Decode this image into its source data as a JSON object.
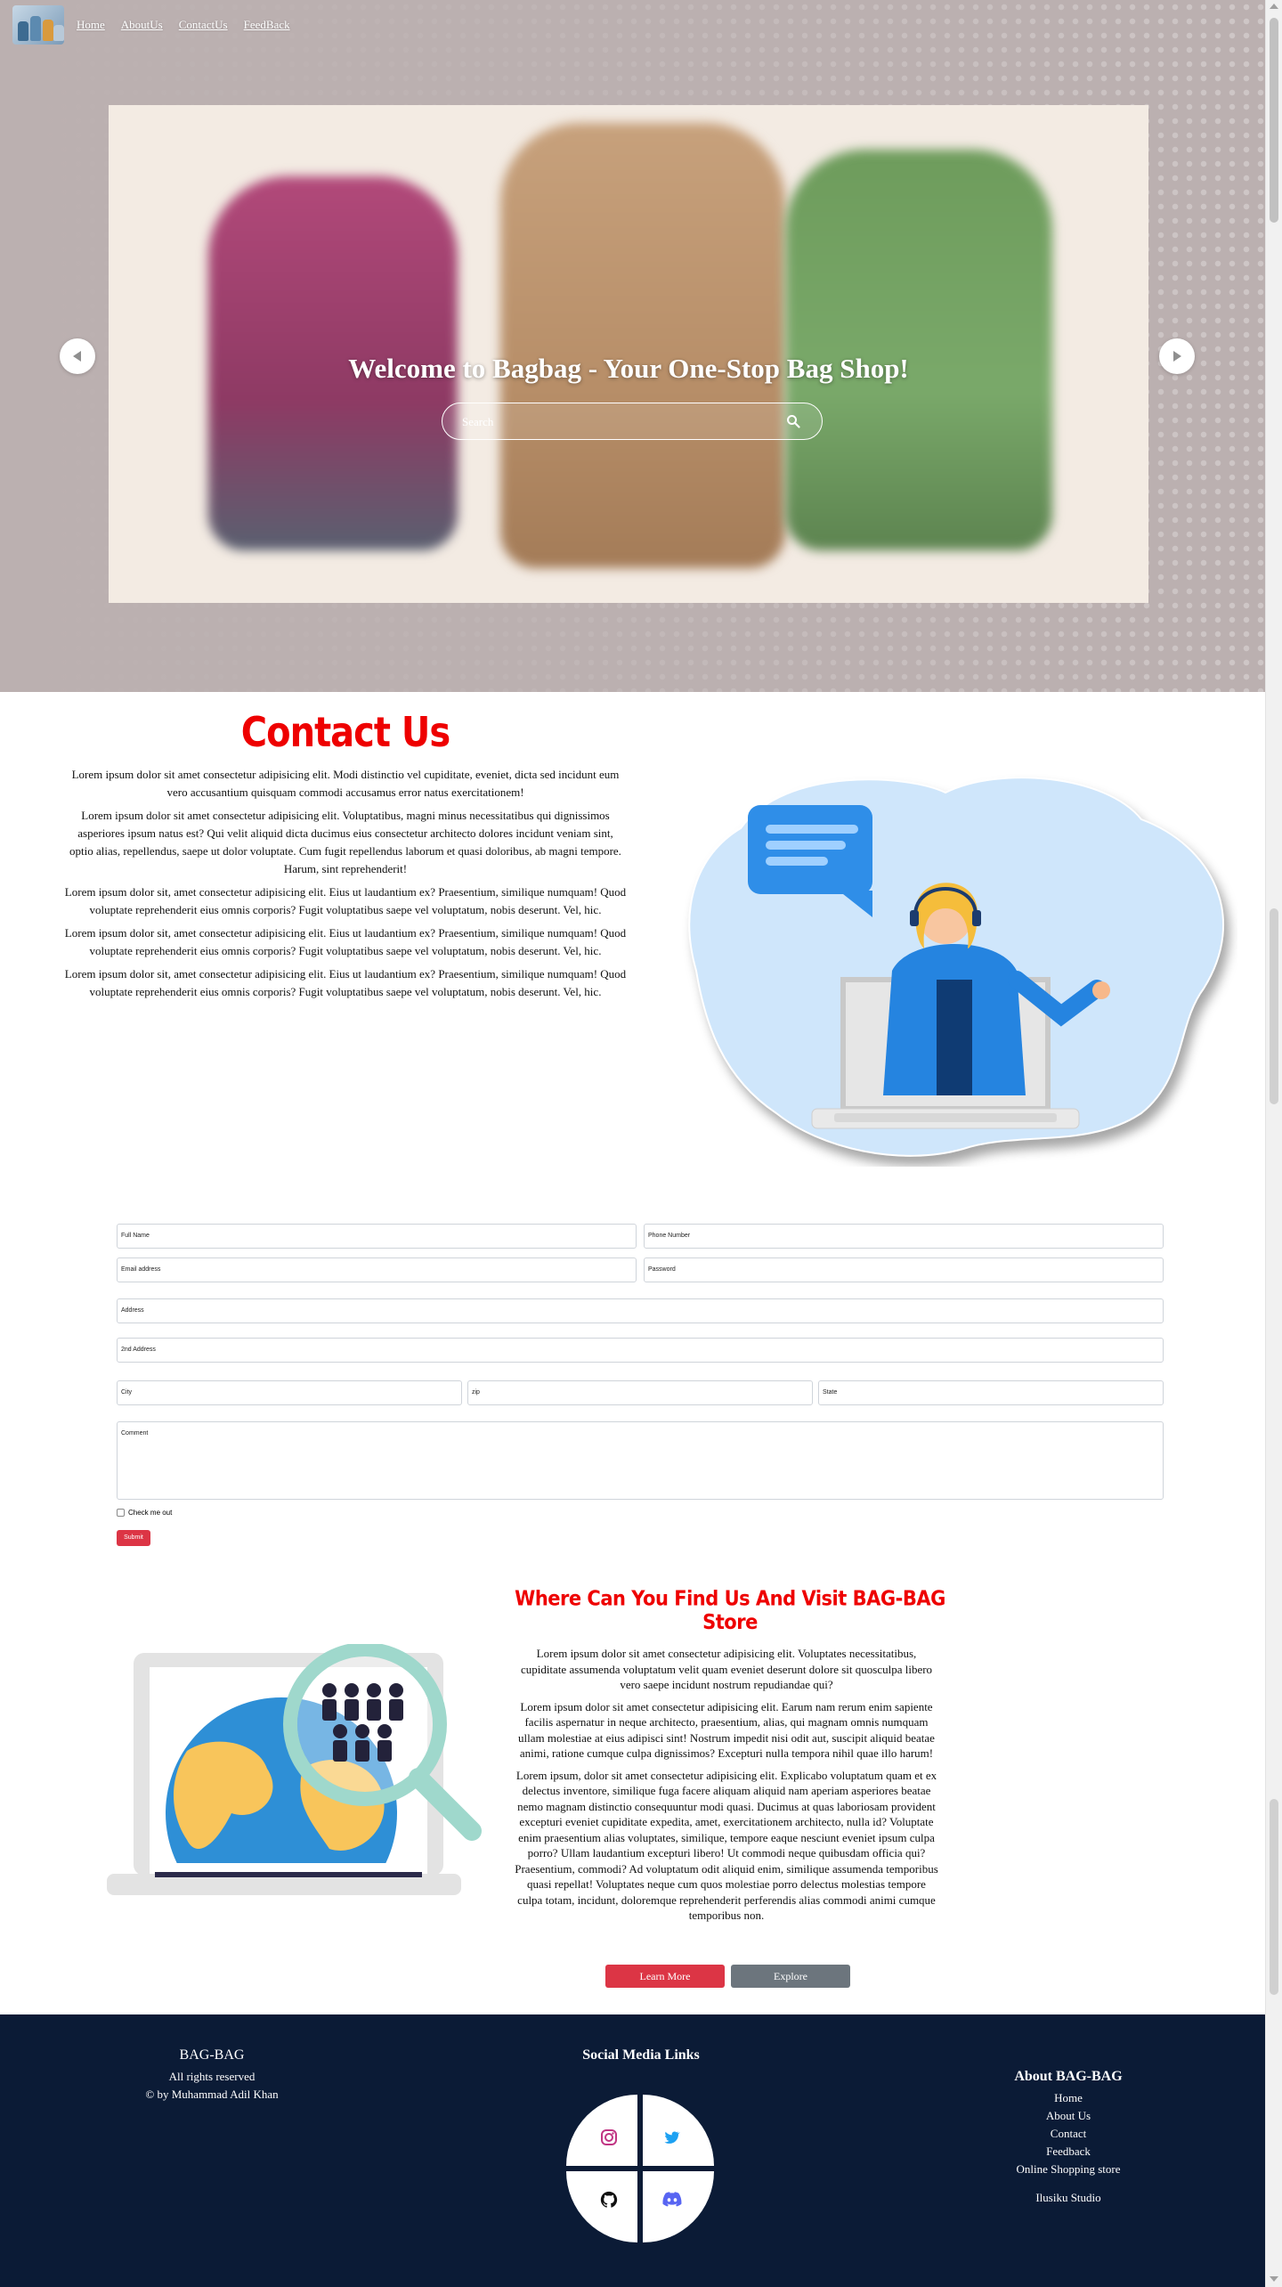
{
  "nav": {
    "logo_alt": "bag-logo",
    "links": [
      "Home",
      "AboutUs",
      "ContactUs",
      "FeedBack"
    ]
  },
  "hero": {
    "title": "Welcome to Bagbag - Your One-Stop Bag Shop!",
    "search_placeholder": "Search"
  },
  "contact": {
    "title": "Contact Us",
    "paragraphs": [
      "Lorem ipsum dolor sit amet consectetur adipisicing elit. Modi distinctio vel cupiditate, eveniet, dicta sed incidunt eum vero accusantium quisquam commodi accusamus error natus exercitationem!",
      "Lorem ipsum dolor sit amet consectetur adipisicing elit. Voluptatibus, magni minus necessitatibus qui dignissimos asperiores ipsum natus est? Qui velit aliquid dicta ducimus eius consectetur architecto dolores incidunt veniam sint,",
      "optio alias, repellendus, saepe ut dolor voluptate. Cum fugit repellendus laborum et quasi doloribus, ab magni tempore. Harum, sint reprehenderit!",
      "Lorem ipsum dolor sit, amet consectetur adipisicing elit. Eius ut laudantium ex? Praesentium, similique numquam! Quod voluptate reprehenderit eius omnis corporis? Fugit voluptatibus saepe vel voluptatum, nobis deserunt. Vel, hic.",
      "Lorem ipsum dolor sit, amet consectetur adipisicing elit. Eius ut laudantium ex? Praesentium, similique numquam! Quod voluptate reprehenderit eius omnis corporis? Fugit voluptatibus saepe vel voluptatum, nobis deserunt. Vel, hic.",
      "Lorem ipsum dolor sit, amet consectetur adipisicing elit. Eius ut laudantium ex? Praesentium, similique numquam! Quod voluptate reprehenderit eius omnis corporis? Fugit voluptatibus saepe vel voluptatum, nobis deserunt. Vel, hic."
    ]
  },
  "form": {
    "full_name": "Full Name",
    "phone": "Phone Number",
    "email": "Email address",
    "password": "Password",
    "address": "Address",
    "address2": "2nd Address",
    "city": "City",
    "zip": "zip",
    "state": "State",
    "comment": "Comment",
    "check_label": "Check me out",
    "submit": "Submit"
  },
  "find": {
    "title": "Where Can You Find Us And Visit BAG-BAG Store",
    "paragraphs": [
      "Lorem ipsum dolor sit amet consectetur adipisicing elit. Voluptates necessitatibus, cupiditate assumenda voluptatum velit quam eveniet deserunt dolore sit quosculpa libero vero saepe incidunt nostrum repudiandae qui?",
      "Lorem ipsum dolor sit amet consectetur adipisicing elit. Earum nam rerum enim sapiente facilis aspernatur in neque architecto, praesentium, alias, qui magnam omnis numquam ullam molestiae at eius adipisci sint! Nostrum impedit nisi odit aut, suscipit aliquid beatae animi, ratione cumque culpa dignissimos? Excepturi nulla tempora nihil quae illo harum!",
      "Lorem ipsum, dolor sit amet consectetur adipisicing elit. Explicabo voluptatum quam et ex delectus inventore, similique fuga facere aliquam aliquid nam aperiam asperiores beatae nemo magnam distinctio consequuntur modi quasi. Ducimus at quas laboriosam provident excepturi eveniet cupiditate expedita, amet, exercitationem architecto, nulla id? Voluptate enim praesentium alias voluptates, similique, tempore eaque nesciunt eveniet ipsum culpa porro? Ullam laudantium excepturi libero! Ut commodi neque quibusdam officia qui? Praesentium, commodi? Ad voluptatum odit aliquid enim, similique assumenda temporibus quasi repellat! Voluptates neque cum quos molestiae porro delectus molestias tempore culpa totam, incidunt, doloremque reprehenderit perferendis alias commodi animi cumque temporibus non."
    ],
    "learn_more": "Learn More",
    "explore": "Explore"
  },
  "footer": {
    "brand": "BAG-BAG",
    "rights": "All rights reserved",
    "credit": "© by Muhammad Adil Khan",
    "social_title": "Social Media Links",
    "about_title": "About BAG-BAG",
    "about_links": [
      "Home",
      "About Us",
      "Contact",
      "Feedback",
      "Online Shopping store"
    ],
    "studio": "Ilusiku Studio"
  },
  "colors": {
    "accent_red": "#ee0000",
    "button_red": "#dc3545",
    "button_gray": "#6c757d",
    "footer_bg": "#0b1b36",
    "instagram": "#c13584",
    "twitter": "#1da1f2",
    "discord": "#5865f2"
  },
  "icons": [
    "search-icon",
    "chevron-left-icon",
    "chevron-right-icon",
    "instagram-icon",
    "twitter-icon",
    "github-icon",
    "discord-icon"
  ]
}
